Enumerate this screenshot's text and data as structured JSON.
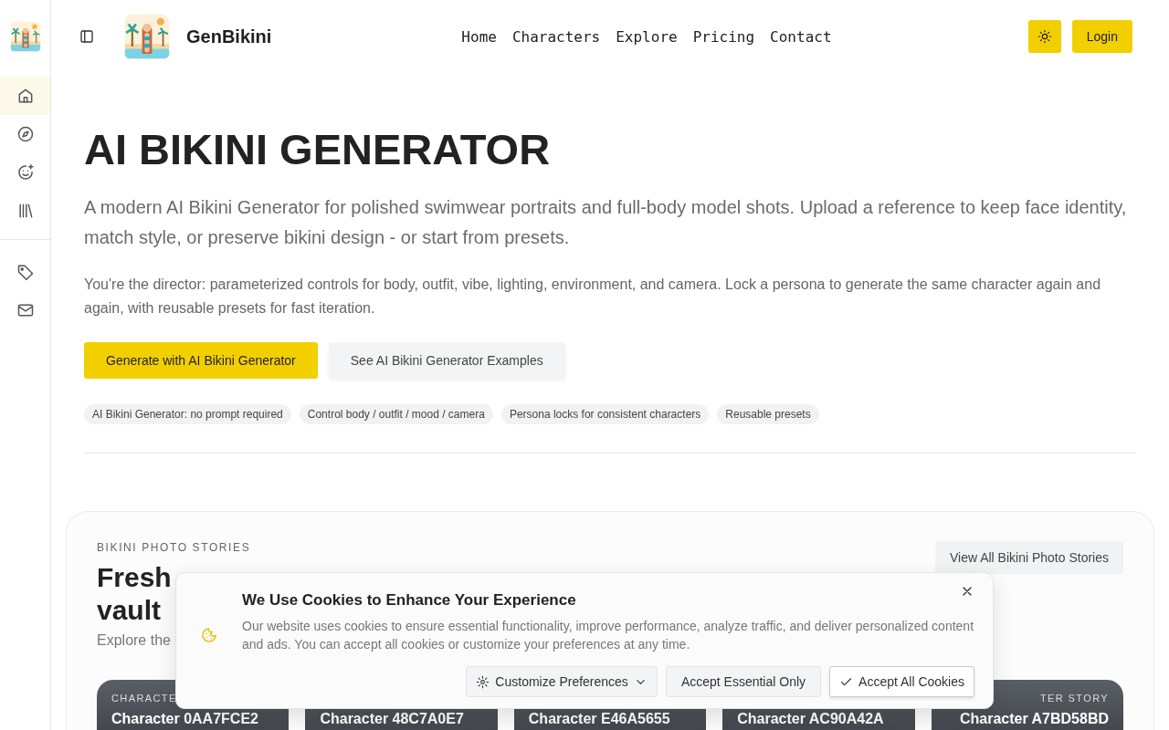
{
  "sidebar": {
    "groups": [
      {
        "items": [
          {
            "selected": true
          },
          {
            "selected": false
          },
          {
            "selected": false
          },
          {
            "selected": false
          }
        ]
      },
      {
        "items": [
          {
            "selected": false
          },
          {
            "selected": false
          }
        ]
      }
    ]
  },
  "header": {
    "brand": "GenBikini",
    "nav": [
      "Home",
      "Characters",
      "Explore",
      "Pricing",
      "Contact"
    ],
    "login": "Login"
  },
  "hero": {
    "title": "AI BIKINI GENERATOR",
    "lead": "A modern AI Bikini Generator for polished swimwear portraits and full-body model shots. Upload a reference to keep face identity, match style, or preserve bikini design - or start from presets.",
    "body": "You're the director: parameterized controls for body, outfit, vibe, lighting, environment, and camera. Lock a persona to generate the same character again and again, with reusable presets for fast iteration.",
    "primary": "Generate with AI Bikini Generator",
    "secondary": "See AI Bikini Generator Examples",
    "tags": [
      "AI Bikini Generator: no prompt required",
      "Control body / outfit / mood / camera",
      "Persona locks for consistent characters",
      "Reusable presets"
    ]
  },
  "stories": {
    "eyebrow": "BIKINI PHOTO STORIES",
    "title_lines": [
      "Fresh",
      "vault"
    ],
    "subtitle": "Explore the",
    "view_all": "View All Bikini Photo Stories",
    "cards": [
      {
        "label": "CHARACTE",
        "title": "Character 0AA7FCE2"
      },
      {
        "title": "Character 48C7A0E7"
      },
      {
        "title": "Character E46A5655"
      },
      {
        "title": "Character AC90A42A"
      },
      {
        "label": "TER STORY",
        "title": "Character A7BD58BD"
      }
    ]
  },
  "cookie_banner": {
    "title": "We Use Cookies to Enhance Your Experience",
    "text": "Our website uses cookies to ensure essential functionality, improve performance, analyze traffic, and deliver personalized content and ads. You can accept all cookies or customize your preferences at any time.",
    "buttons": [
      {
        "kind": "menu",
        "label": "Customize Preferences"
      },
      {
        "kind": "plain",
        "label": "Accept Essential Only"
      },
      {
        "kind": "confirm",
        "label": "Accept All Cookies"
      }
    ]
  }
}
